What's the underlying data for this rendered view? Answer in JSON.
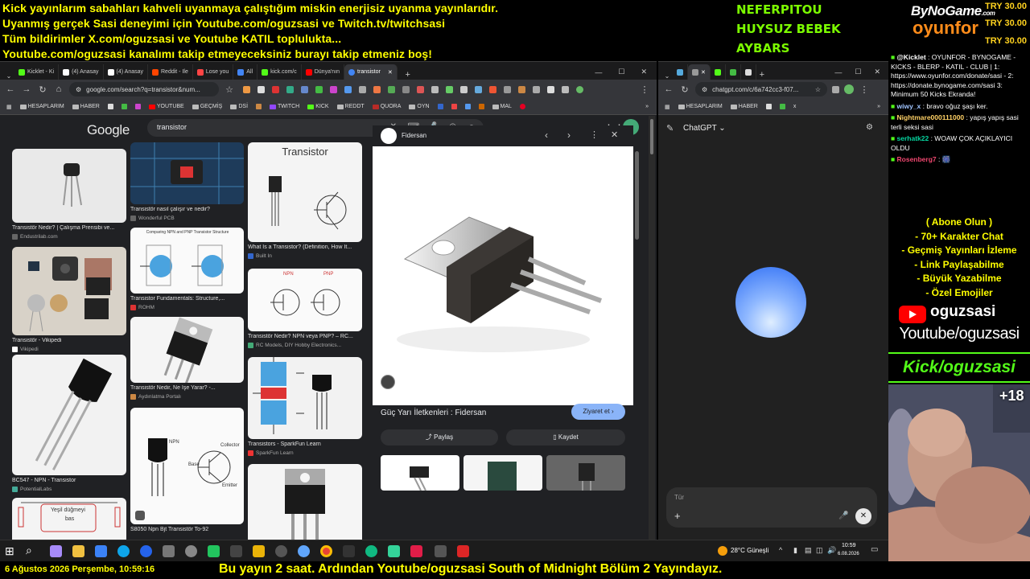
{
  "banner": {
    "lines": [
      "Kick yayınlarım sabahları kahveli uyanmaya çalıştığım miskin enerjisiz uyanma yayınlarıdır.",
      "Uyanmış gerçek Sasi deneyimi için Youtube.com/oguzsasi ve Twitch.tv/twitchsasi",
      "Tüm bildirimler X.com/oguzsasi ve Youtube KATIL toplulukta...",
      "Youtube.com/oguzsasi kanalımı takip etmeyeceksiniz burayı takip etmeniz boş!"
    ]
  },
  "donors": [
    "NEFERPITOU",
    "HUYSUZ BEBEK",
    "AYBARS"
  ],
  "sponsor": {
    "brand_top": "ByNoGame",
    "brand_top_suffix": ".com",
    "brand_bottom": "oyunfor",
    "amounts": [
      "TRY 30.00",
      "TRY 30.00",
      "TRY 30.00"
    ]
  },
  "left_browser": {
    "tabs": [
      {
        "label": "Kicklet - Ki",
        "color": "#53fc18"
      },
      {
        "label": "(4) Anasay",
        "color": "#ffffff"
      },
      {
        "label": "(4) Anasay",
        "color": "#ffffff"
      },
      {
        "label": "Reddit - Ile",
        "color": "#ff4500"
      },
      {
        "label": "Lose you",
        "color": "#ff4444"
      },
      {
        "label": "All",
        "color": "#4285f4"
      },
      {
        "label": "kick.com/c",
        "color": "#53fc18"
      },
      {
        "label": "Dünya'nın",
        "color": "#ff0000"
      },
      {
        "label": "transistor",
        "color": "#4285f4"
      }
    ],
    "url": "google.com/search?q=transistor&num...",
    "bookmarks": [
      "HESAPLARIM",
      "HABER",
      "YOUTUBE",
      "GEÇMİŞ",
      "DSİ",
      "TWITCH",
      "KICK",
      "REDDT",
      "QUORA",
      "OYN",
      "MAL"
    ],
    "google_logo": "Google",
    "search_query": "transistor",
    "results": {
      "col1": [
        {
          "caption": "Transistör Nedir? | Çalışma Prensibi ve...",
          "source": "Endustrilab.com"
        },
        {
          "caption": "Transistör - Vikipedi",
          "source": "Vikipedi"
        },
        {
          "caption": "BC547 - NPN - Transistor",
          "source": "PotentialLabs"
        }
      ],
      "col2": [
        {
          "caption": "Transistör nasıl çalışır ve nedir?",
          "source": "Wonderful PCB"
        },
        {
          "caption": "Transistor Fundamentals: Structure,...",
          "source": "ROHM"
        },
        {
          "caption": "Transistör Nedir, Ne İşe Yarar? -...",
          "source": "Aydınlatma Portalı"
        },
        {
          "caption": "S8050 Npn Bjt Transistör To-92",
          "source": ""
        }
      ],
      "col3": [
        {
          "caption": "What Is a Transistor? (Definition, How It...",
          "source": "Built In"
        },
        {
          "caption": "Transistör Nedir? NPN veya PNP? – RC...",
          "source": "RC Models, DIY Hobby Electronics..."
        },
        {
          "caption": "Transistors - SparkFun Learn",
          "source": "SparkFun Learn"
        }
      ],
      "tile_texts": {
        "transistor_title": "Transistor",
        "npn_pnp_heading": "Comparing NPN and PNP Transistor Structure",
        "yesil": "Yeşil düğmeyi",
        "bas": "bas",
        "npn": "NPN",
        "pnp": "PNP",
        "collector": "Collector",
        "base": "Base",
        "emitter": "Emitter"
      }
    },
    "preview": {
      "source": "Fidersan",
      "title": "Güç Yarı İletkenleri : Fidersan",
      "visit_label": "Ziyaret et",
      "share_label": "Paylaş",
      "save_label": "Kaydet"
    }
  },
  "right_browser": {
    "url": "chatgpt.com/c/6a742cc3-f07...",
    "bookmarks": [
      "HESAPLARIM",
      "HABER",
      "x"
    ],
    "app_title": "ChatGPT",
    "input_placeholder": "Tür"
  },
  "chat": {
    "messages": [
      {
        "user": "@Kicklet",
        "text": " : OYUNFOR - BYNOGAME - KICKS - BLERP - KATIL - CLUB | 1: https://www.oyunfor.com/donate/sasi - 2: https://donate.bynogame.com/sasi 3: Minimum 50 Kicks Ekranda!",
        "color": "#ffffff"
      },
      {
        "user": "wiwy_x",
        "text": " : bravo oğuz şaşı ker.",
        "color": "#a0c4ff"
      },
      {
        "user": "Nightmare000111000",
        "text": " : yapış yapış sasi terli seksi sasi",
        "color": "#ffd166"
      },
      {
        "user": "serhatk22",
        "text": " : WOAW ÇOK AÇIKLAYICI OLDU",
        "color": "#06d6a0"
      },
      {
        "user": "Rosenberg7",
        "text": " : 🎆",
        "color": "#ef476f"
      }
    ]
  },
  "promo": {
    "lines": [
      "( Abone Olun )",
      "- 70+ Karakter Chat",
      "- Geçmiş Yayınları İzleme",
      "- Link Paylaşabilme",
      "- Büyük Yazabilme",
      "- Özel Emojiler"
    ],
    "yt_name": "oguzsasi",
    "yt_url": "Youtube/oguzsasi",
    "kick_label": "Kick/oguzsasi",
    "viewer_badge": "+18"
  },
  "taskbar": {
    "weather": "28°C Güneşli",
    "time": "10:59",
    "date": "6.08.2026"
  },
  "ticker": {
    "datetime": "6 Ağustos 2026 Perşembe, 10:59:16",
    "message": "Bu yayın 2 saat. Ardından Youtube/oguzsasi South of Midnight Bölüm 2 Yayındayız."
  },
  "colors": {
    "banner": "#ffff00",
    "donor": "#7cfc00",
    "kick_green": "#53fc18",
    "ticker": "#ffff00",
    "visit_button": "#8ab4f8"
  }
}
